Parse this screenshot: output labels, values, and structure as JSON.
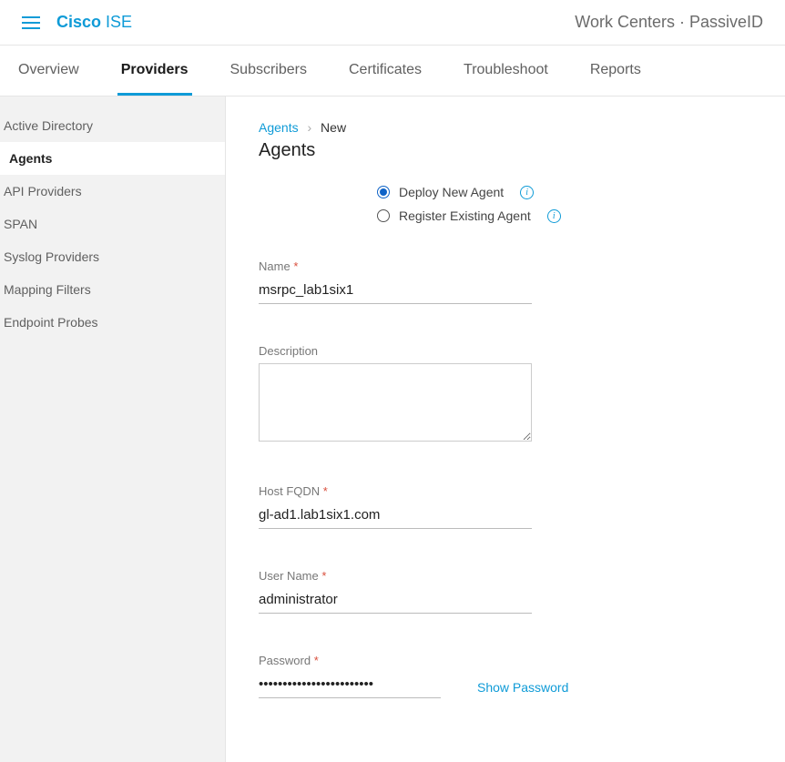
{
  "brand": {
    "bold": "Cisco",
    "light": " ISE"
  },
  "header_path": "Work Centers · PassiveID",
  "tabs": [
    {
      "label": "Overview",
      "active": false
    },
    {
      "label": "Providers",
      "active": true
    },
    {
      "label": "Subscribers",
      "active": false
    },
    {
      "label": "Certificates",
      "active": false
    },
    {
      "label": "Troubleshoot",
      "active": false
    },
    {
      "label": "Reports",
      "active": false
    }
  ],
  "sidebar": [
    {
      "label": "Active Directory",
      "active": false
    },
    {
      "label": "Agents",
      "active": true
    },
    {
      "label": "API Providers",
      "active": false
    },
    {
      "label": "SPAN",
      "active": false
    },
    {
      "label": "Syslog Providers",
      "active": false
    },
    {
      "label": "Mapping Filters",
      "active": false
    },
    {
      "label": "Endpoint Probes",
      "active": false
    }
  ],
  "breadcrumb": {
    "link": "Agents",
    "current": "New"
  },
  "page_title": "Agents",
  "radios": {
    "deploy": "Deploy New Agent",
    "register": "Register Existing Agent"
  },
  "fields": {
    "name": {
      "label": "Name",
      "value": "msrpc_lab1six1"
    },
    "description": {
      "label": "Description",
      "value": ""
    },
    "host": {
      "label": "Host FQDN",
      "value": "gl-ad1.lab1six1.com"
    },
    "user": {
      "label": "User Name",
      "value": "administrator"
    },
    "password": {
      "label": "Password",
      "value": "••••••••••••••••••••••••"
    },
    "show_password": "Show Password"
  }
}
